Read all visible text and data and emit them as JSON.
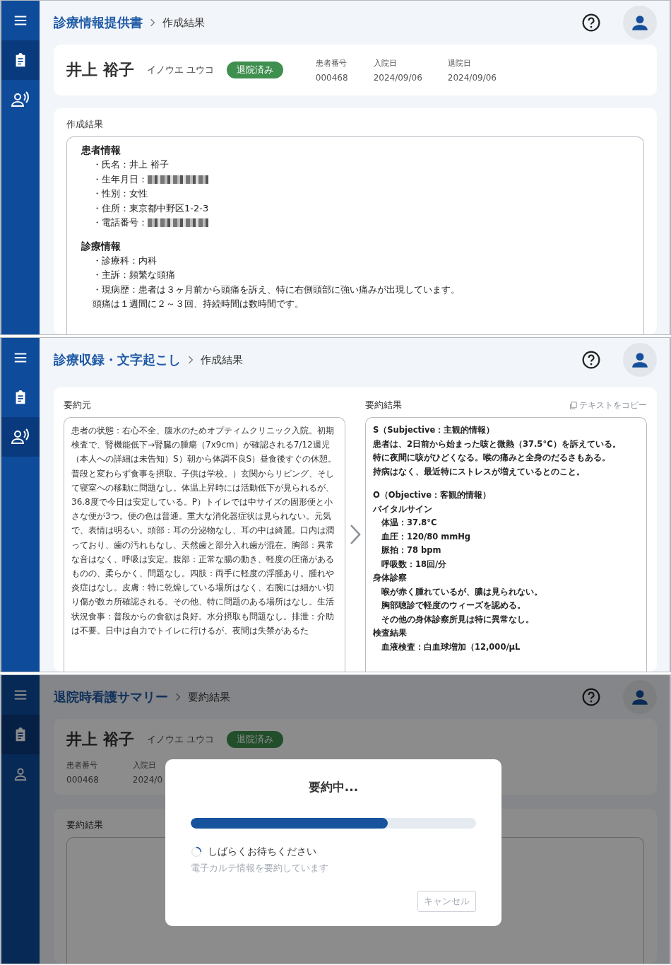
{
  "panels": [
    {
      "kind": "document",
      "sidebar": [
        {
          "kind": "menu",
          "selected": false
        },
        {
          "kind": "clipboard",
          "selected": true
        },
        {
          "kind": "voice",
          "selected": false
        }
      ],
      "breadcrumb": {
        "parent": "診療情報提供書",
        "current": "作成結果"
      },
      "patient": {
        "kind": "inline",
        "name": "井上 裕子",
        "kana": "イノウエ ユウコ",
        "status": "退院済み",
        "fields": [
          {
            "label": "患者番号",
            "value": "000468"
          },
          {
            "label": "入院日",
            "value": "2024/09/06"
          },
          {
            "label": "退院日",
            "value": "2024/09/06"
          }
        ]
      },
      "result": {
        "label": "作成結果",
        "sections": [
          {
            "heading": "患者情報",
            "lines": [
              {
                "text": "・氏名：井上 裕子",
                "redacted": false
              },
              {
                "text": "・生年月日：",
                "redacted": true
              },
              {
                "text": "・性別：女性",
                "redacted": false
              },
              {
                "text": "・住所：東京都中野区1-2-3",
                "redacted": false
              },
              {
                "text": "・電話番号：",
                "redacted": true
              }
            ]
          },
          {
            "heading": "診療情報",
            "lines": [
              {
                "text": "・診療科：内科",
                "redacted": false
              },
              {
                "text": "・主訴：頻繁な頭痛",
                "redacted": false
              },
              {
                "text": "・現病歴：患者は３ヶ月前から頭痛を訴え、特に右側頭部に強い痛みが出現しています。",
                "redacted": false
              },
              {
                "text": "頭痛は１週間に２～３回、持続時間は数時間です。",
                "redacted": false
              }
            ]
          }
        ]
      }
    },
    {
      "kind": "summary",
      "sidebar": [
        {
          "kind": "menu",
          "selected": false
        },
        {
          "kind": "clipboard",
          "selected": false
        },
        {
          "kind": "voice",
          "selected": true
        }
      ],
      "breadcrumb": {
        "parent": "診療収録・文字起こし",
        "current": "作成結果"
      },
      "source": {
        "label": "要約元",
        "text": "患者の状態：右心不全、腹水のためオプティムクリニック入院。初期検査で、腎機能低下→腎臓の腫瘍（7x9cm）が確認される7/12週児（本人への詳細は未告知）S）朝から体調不良S）昼食後すぐの休憩。普段と変わらず食事を摂取。子供は学校。）玄関からリビング、そして寝室への移動に問題なし。体温上昇時には活動低下が見られるが、36.8度で今日は安定している。P）トイレでは中サイズの固形便と小さな便が3つ。便の色は普通。重大な消化器症状は見られない。元気で、表情は明るい。頭部：耳の分泌物なし、耳の中は綺麗。口内は潤っており、歯の汚れもなし、天然歯と部分入れ歯が混在。胸部：異常な音はなく、呼吸は安定。腹部：正常な腸の動き、軽度の圧痛があるものの、柔らかく、問題なし。四肢：両手に軽度の浮腫あり。腫れや炎症はなし。皮膚：特に乾燥している場所はなく、右腕には細かい切り傷が数カ所確認される。その他、特に問題のある場所はなし。生活状況食事：普段からの食欲は良好。水分摂取も問題なし。排泄：介助は不要。日中は自力でトイレに行けるが、夜間は失禁があるた"
      },
      "summary": {
        "label": "要約結果",
        "copy": "テキストをコピー",
        "lines": [
          {
            "kind": "section",
            "text": "S（Subjective：主観的情報）"
          },
          {
            "kind": "text",
            "text": "患者は、2日前から始まった咳と微熱（37.5°C）を訴えている。"
          },
          {
            "kind": "text",
            "text": "特に夜間に咳がひどくなる。喉の痛みと全身のだるさもある。"
          },
          {
            "kind": "text",
            "text": "持病はなく、最近特にストレスが増えているとのこと。"
          },
          {
            "kind": "section",
            "text": "O（Objective：客観的情報）"
          },
          {
            "kind": "text",
            "text": "バイタルサイン"
          },
          {
            "kind": "item",
            "text": "体温：37.8°C"
          },
          {
            "kind": "item",
            "text": "血圧：120/80 mmHg"
          },
          {
            "kind": "item",
            "text": "脈拍：78 bpm"
          },
          {
            "kind": "item",
            "text": "呼吸数：18回/分"
          },
          {
            "kind": "text",
            "text": "身体診察"
          },
          {
            "kind": "item",
            "text": "喉が赤く腫れているが、膿は見られない。"
          },
          {
            "kind": "item",
            "text": "胸部聴診で軽度のウィーズを認める。"
          },
          {
            "kind": "item",
            "text": "その他の身体診察所見は特に異常なし。"
          },
          {
            "kind": "text",
            "text": "検査結果"
          },
          {
            "kind": "item",
            "text": "血液検査：白血球増加（12,000/μL"
          }
        ]
      }
    },
    {
      "kind": "dialog",
      "sidebar": [
        {
          "kind": "menu",
          "selected": false
        },
        {
          "kind": "clipboard",
          "selected": true
        },
        {
          "kind": "person",
          "selected": false
        }
      ],
      "breadcrumb": {
        "parent": "退院時看護サマリー",
        "current": "要約結果"
      },
      "patient": {
        "kind": "stacked",
        "name": "井上 裕子",
        "kana": "イノウエ ユウコ",
        "status": "退院済み",
        "fields": [
          {
            "label": "患者番号",
            "value": "000468"
          },
          {
            "label": "入院日",
            "value": "2024/0"
          }
        ]
      },
      "result": {
        "label": "要約結果"
      },
      "dialog": {
        "title": "要約中...",
        "level": 0.69,
        "status": "しばらくお待ちください",
        "message": "電子カルテ情報を要約しています",
        "cancel": {
          "label": "キャンセル",
          "disabled": true
        }
      }
    }
  ]
}
